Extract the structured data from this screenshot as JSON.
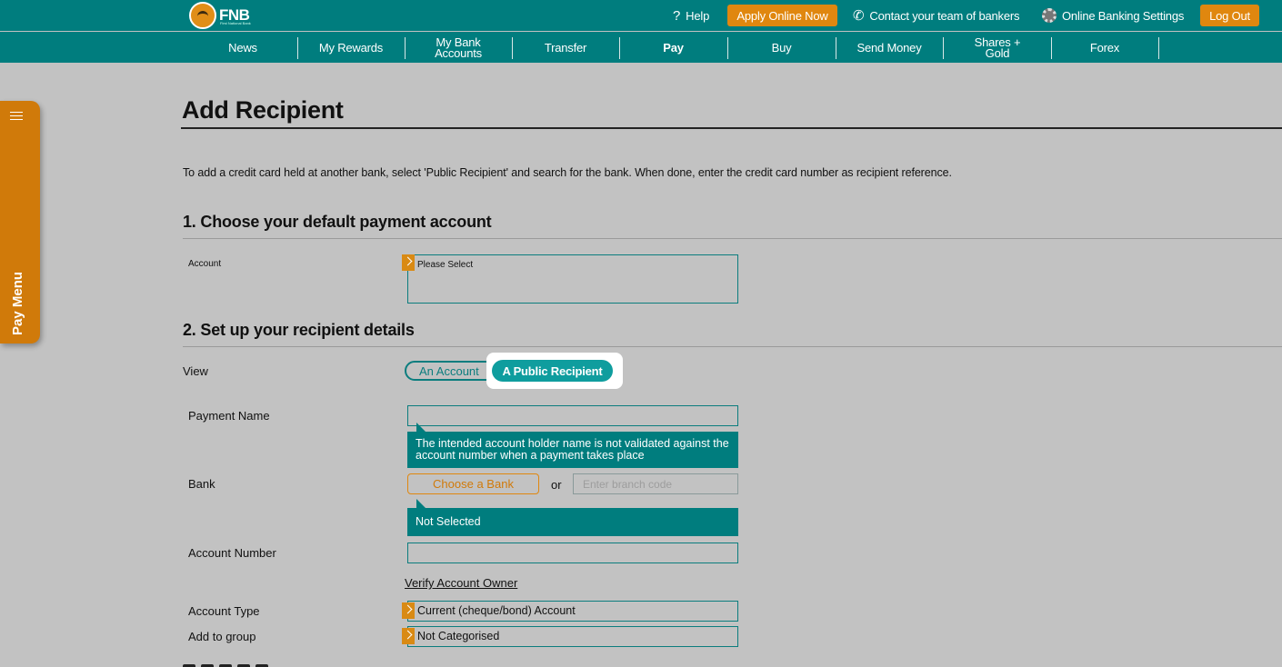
{
  "header": {
    "logo_text": "FNB",
    "logo_subtext": "First National Bank",
    "help": "Help",
    "apply": "Apply Online Now",
    "contact": "Contact your team of bankers",
    "settings": "Online Banking Settings",
    "logout": "Log Out"
  },
  "nav": {
    "items": [
      "News",
      "My Rewards",
      "My Bank Accounts",
      "Transfer",
      "Pay",
      "Buy",
      "Send Money",
      "Shares + Gold",
      "Forex"
    ]
  },
  "pay_menu": {
    "label": "Pay Menu"
  },
  "page": {
    "title": "Add Recipient",
    "intro": "To add a credit card held at another bank, select 'Public Recipient' and search for the bank. When done, enter the credit card number as recipient reference."
  },
  "section1": {
    "title": "1. Choose your default payment account",
    "account_label": "Account",
    "account_value": "Please Select"
  },
  "section2": {
    "title": "2. Set up your recipient details",
    "view_label": "View",
    "toggle_account": "An Account",
    "toggle_public": "A Public Recipient",
    "payment_name_label": "Payment Name",
    "payment_name_value": "",
    "payment_name_tip": "The intended account holder name is not validated against the account number when a payment takes place",
    "bank_label": "Bank",
    "choose_bank": "Choose a Bank",
    "or": "or",
    "branch_placeholder": "Enter branch code",
    "bank_status": "Not Selected",
    "account_number_label": "Account Number",
    "account_number_value": "",
    "verify": "Verify Account Owner",
    "account_type_label": "Account Type",
    "account_type_value": "Current (cheque/bond) Account",
    "group_label": "Add to group",
    "group_value": "Not Categorised"
  },
  "colors": {
    "teal": "#007d7e",
    "orange": "#e0870f",
    "background": "#c2c2c2"
  }
}
